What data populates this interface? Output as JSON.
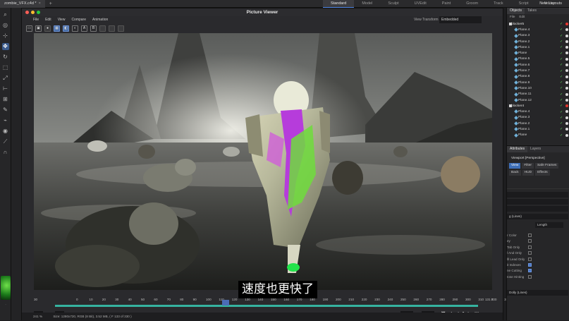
{
  "topbar": {
    "doc_tab": "zombie_VFX.c4d *",
    "close": "×",
    "plus": "+",
    "layouts": [
      "Standard",
      "Model",
      "Sculpt",
      "UVEdit",
      "Paint",
      "Groom",
      "Track",
      "Script",
      "Nodes"
    ],
    "active_layout": "Standard",
    "new_layouts": "New Layouts"
  },
  "viewer": {
    "title": "Picture Viewer",
    "menu": [
      "File",
      "Edit",
      "View",
      "Compare",
      "Animation"
    ],
    "view_transform_label": "View Transform",
    "view_transform_value": "Embedded",
    "subtitle": "速度也更快了"
  },
  "timeline": {
    "left_value": "30",
    "ticks": [
      "0",
      "10",
      "20",
      "30",
      "40",
      "50",
      "60",
      "70",
      "80",
      "90",
      "100",
      "110",
      "120",
      "130",
      "140",
      "150",
      "160",
      "170",
      "180",
      "190",
      "200",
      "210",
      "220",
      "230",
      "240",
      "250",
      "260",
      "270",
      "280",
      "290",
      "300",
      "310",
      "320",
      "33("
    ],
    "right_value": "131 F",
    "start_field": "0 F",
    "start_field2": "0 F",
    "end_field": "328 F",
    "end_field2": "328 F",
    "zoom": "241 %",
    "status": "Size: 1280x720, RGB (8 Bit), 3.52 MB,  ( F 133 of 330 )"
  },
  "objects": {
    "tabs": [
      "Objects",
      "Takes"
    ],
    "menu": [
      "File",
      "Edit"
    ],
    "rows": [
      {
        "name": "blocker5",
        "group": true,
        "dot": "red"
      },
      {
        "name": "Plane.4"
      },
      {
        "name": "Plane.3"
      },
      {
        "name": "Plane.2"
      },
      {
        "name": "Plane.1"
      },
      {
        "name": "Plane"
      },
      {
        "name": "Plane.5"
      },
      {
        "name": "Plane.6"
      },
      {
        "name": "Plane.7"
      },
      {
        "name": "Plane.8"
      },
      {
        "name": "Plane.9"
      },
      {
        "name": "Plane.10"
      },
      {
        "name": "Plane.11"
      },
      {
        "name": "Plane.12"
      },
      {
        "name": "blocker4",
        "group": true,
        "dot": "red"
      },
      {
        "name": "Plane.4"
      },
      {
        "name": "Plane.3"
      },
      {
        "name": "Plane.2"
      },
      {
        "name": "Plane.1"
      },
      {
        "name": "Plane"
      }
    ]
  },
  "attributes": {
    "tabs": [
      "Attributes",
      "Layers"
    ],
    "viewport": "Viewport [Perspective]",
    "chips": [
      "View",
      "Filter",
      "Safe Frames",
      "Back",
      "HUD",
      "Effects"
    ],
    "active_chip": "View",
    "field1": "g (Lines)",
    "field2": "Length",
    "props": [
      "r Color",
      "ey",
      "Tab Only",
      "l And Only",
      "lll Lead Only",
      "it Indexes",
      "ne Cutting",
      "Iose Hinting"
    ],
    "bottom": "Dolly (Lines)"
  }
}
